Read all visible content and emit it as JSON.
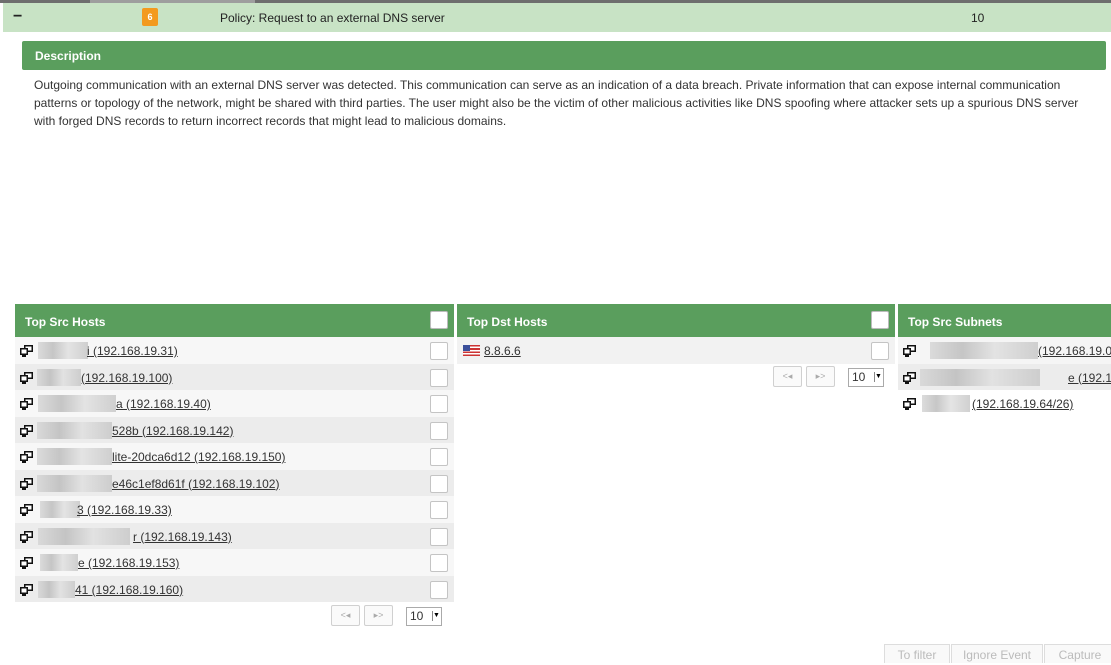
{
  "event": {
    "collapse": "−",
    "severity": "6",
    "policy": "Policy: Request to an external DNS server",
    "count": "10",
    "colors": {
      "row_bg": "#c8e3c5",
      "severity_bg": "#f39a1e",
      "accent": "#5a9e5d"
    }
  },
  "description": {
    "header": "Description",
    "text": "Outgoing communication with an external DNS server was detected. This communication can serve as an indication of a data breach. Private information that can expose internal communication patterns or topology of the network, might be shared with third parties. The user might also be the victim of other malicious activities like DNS spoofing where attacker sets up a spurious DNS server with forged DNS records to return incorrect records that might lead to malicious domains."
  },
  "src_hosts": {
    "title": "Top Src Hosts",
    "icon": "host-icon",
    "rows": [
      {
        "label": "i (192.168.19.31)"
      },
      {
        "label": "(192.168.19.100)"
      },
      {
        "label": "a (192.168.19.40)"
      },
      {
        "label": "528b (192.168.19.142)"
      },
      {
        "label": "lite-20dca6d12 (192.168.19.150)"
      },
      {
        "label": "e46c1ef8d61f (192.168.19.102)"
      },
      {
        "label": "3 (192.168.19.33)"
      },
      {
        "label": "r (192.168.19.143)"
      },
      {
        "label": "e (192.168.19.153)"
      },
      {
        "label": "41 (192.168.19.160)"
      }
    ],
    "pager": {
      "prev": "<◂",
      "next": "▸>",
      "page_size": "10"
    }
  },
  "dst_hosts": {
    "title": "Top Dst Hosts",
    "rows": [
      {
        "label": "8.8.6.6",
        "icon": "us-flag-icon"
      }
    ],
    "pager": {
      "prev": "<◂",
      "next": "▸>",
      "page_size": "10"
    }
  },
  "src_subnets": {
    "title": "Top Src Subnets",
    "rows": [
      {
        "label": "(192.168.19.0"
      },
      {
        "label": "e (192.16"
      },
      {
        "label": "(192.168.19.64/26)"
      }
    ]
  },
  "actions": {
    "to_filter": "To filter",
    "ignore_event": "Ignore Event",
    "capture": "Capture"
  }
}
